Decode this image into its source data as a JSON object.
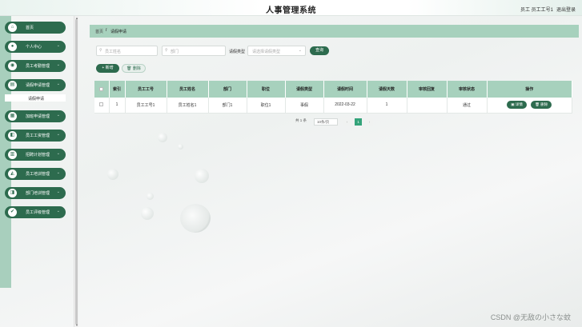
{
  "header": {
    "title": "人事管理系统",
    "user_info": "员工 员工工号1",
    "logout_label": "退出登录"
  },
  "sidebar": {
    "items": [
      {
        "label": "首页",
        "icon": "home-icon",
        "glyph": "⌂"
      },
      {
        "label": "个人中心",
        "icon": "user-icon",
        "glyph": "●"
      },
      {
        "label": "员工考勤管理",
        "icon": "attendance-icon",
        "glyph": "◉"
      },
      {
        "label": "请假申请管理",
        "icon": "leave-icon",
        "glyph": "▤"
      },
      {
        "label": "加班申请管理",
        "icon": "overtime-icon",
        "glyph": "▦"
      },
      {
        "label": "员工工资管理",
        "icon": "salary-icon",
        "glyph": "◧"
      },
      {
        "label": "招聘计划管理",
        "icon": "recruit-icon",
        "glyph": "▥"
      },
      {
        "label": "员工培训管理",
        "icon": "training-icon",
        "glyph": "◭"
      },
      {
        "label": "部门培训管理",
        "icon": "dept-training-icon",
        "glyph": "◨"
      },
      {
        "label": "员工评级管理",
        "icon": "rating-icon",
        "glyph": "✔"
      }
    ],
    "submenu": {
      "label": "请假申请"
    },
    "chevron": "⌄"
  },
  "breadcrumb": {
    "home": "首页",
    "separator": "/",
    "current": "请假申请"
  },
  "search": {
    "employee_name_placeholder": "员工姓名",
    "department_placeholder": "部门",
    "leave_type_label": "请假类型",
    "leave_type_placeholder": "请选择请假类型",
    "query_label": "查询"
  },
  "actions": {
    "add_label": "+ 新增",
    "delete_label": "删除"
  },
  "table": {
    "columns": [
      "",
      "索引",
      "员工工号",
      "员工姓名",
      "部门",
      "职位",
      "请假类型",
      "请假时间",
      "请假天数",
      "审核回复",
      "审核状态",
      "操作"
    ],
    "rows": [
      {
        "index": "1",
        "emp_no": "员工工号1",
        "emp_name": "员工姓名1",
        "dept": "部门1",
        "position": "职位1",
        "leave_type": "事假",
        "leave_time": "2022-03-22",
        "days": "1",
        "reply": "",
        "status": "通过"
      }
    ],
    "detail_label": "详情",
    "row_delete_label": "删除"
  },
  "pagination": {
    "total": "共 1 条",
    "page_size": "10条/页",
    "prev": "‹",
    "current_page": "1",
    "next": "›"
  },
  "watermark": "CSDN @无敌の小さな蚊"
}
